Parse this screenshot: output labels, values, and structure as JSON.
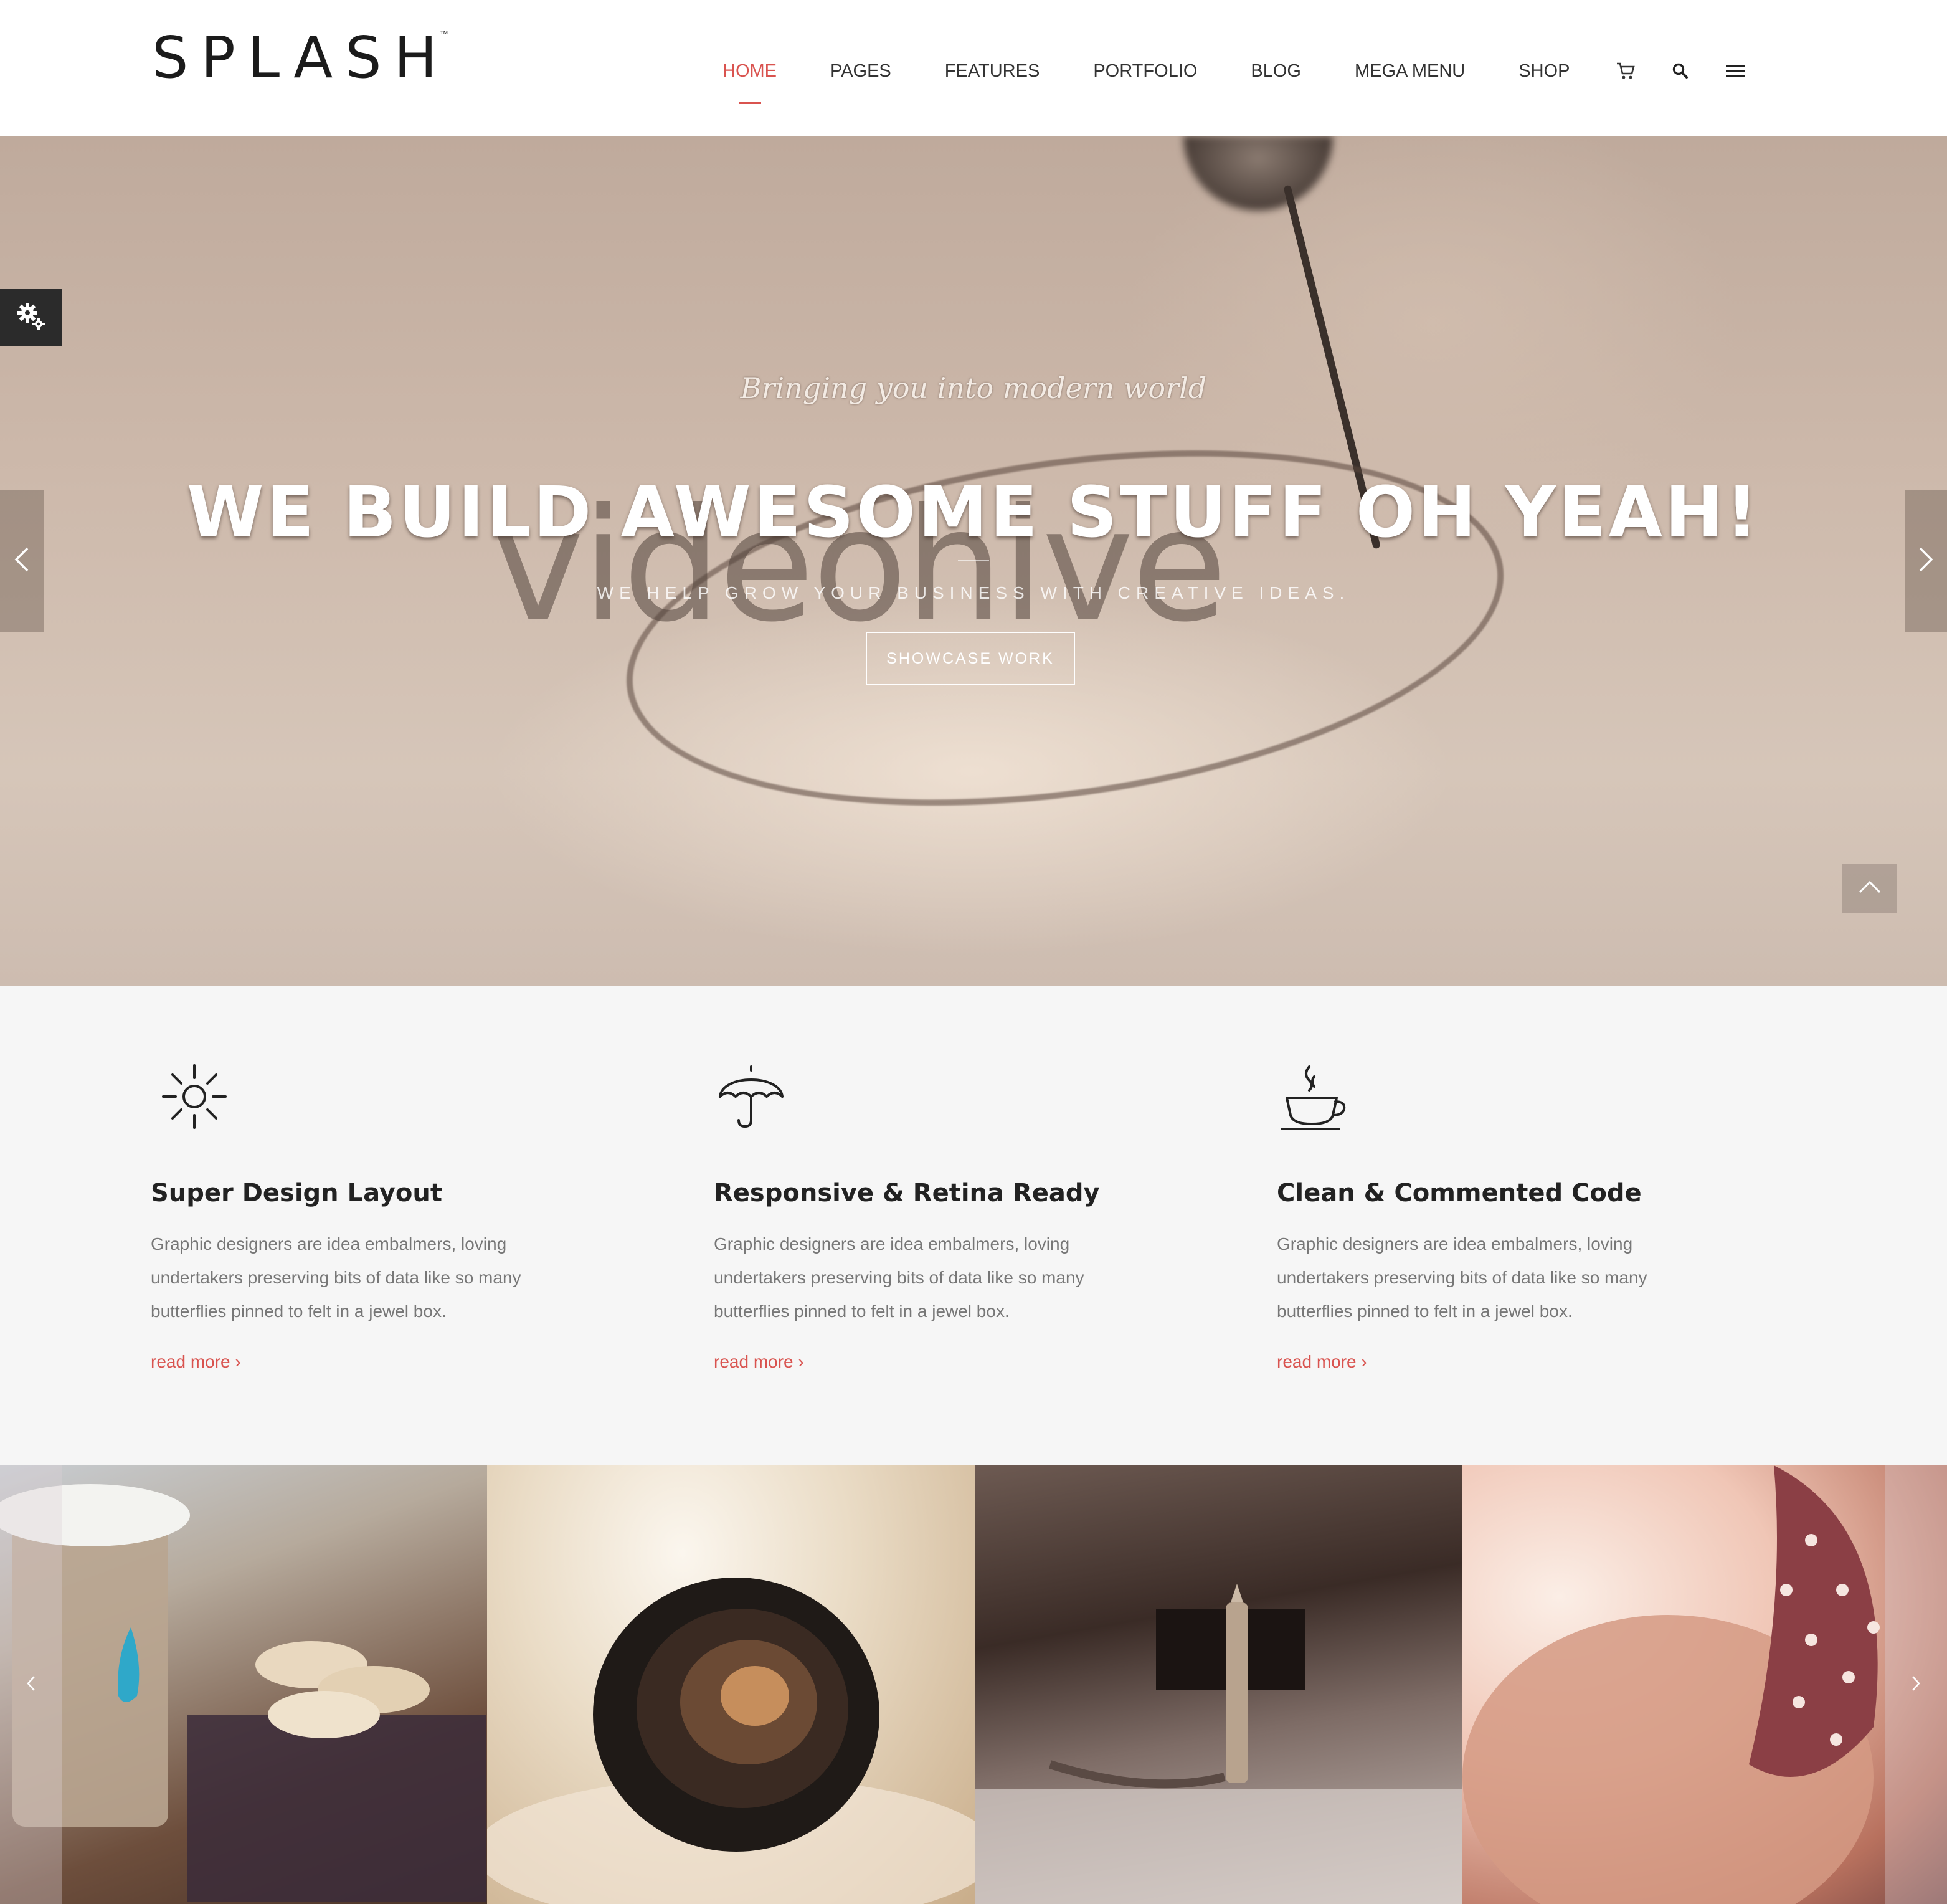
{
  "brand": {
    "logo_text": "SPLASH",
    "logo_tm": "™"
  },
  "nav": {
    "items": [
      {
        "label": "HOME",
        "active": true
      },
      {
        "label": "PAGES",
        "active": false
      },
      {
        "label": "FEATURES",
        "active": false
      },
      {
        "label": "PORTFOLIO",
        "active": false
      },
      {
        "label": "BLOG",
        "active": false
      },
      {
        "label": "MEGA MENU",
        "active": false
      },
      {
        "label": "SHOP",
        "active": false
      }
    ],
    "icons": [
      "cart-icon",
      "search-icon",
      "menu-icon"
    ]
  },
  "hero": {
    "tagline": "Bringing you into modern world",
    "title": "WE BUILD AWESOME STUFF OH YEAH!",
    "subtitle": "WE HELP GROW YOUR BUSINESS WITH CREATIVE IDEAS.",
    "cta_label": "SHOWCASE WORK",
    "watermark": "videohive"
  },
  "features": [
    {
      "icon": "sun-icon",
      "title": "Super Design Layout",
      "text": "Graphic designers are idea embalmers, loving undertakers preserving bits of data like so many butterflies pinned to felt in a jewel box.",
      "link": "read more ›"
    },
    {
      "icon": "umbrella-icon",
      "title": "Responsive & Retina Ready",
      "text": "Graphic designers are idea embalmers, loving undertakers preserving bits of data like so many butterflies pinned to felt in a jewel box.",
      "link": "read more ›"
    },
    {
      "icon": "coffee-cup-icon",
      "title": "Clean & Commented Code",
      "text": "Graphic designers are idea embalmers, loving undertakers preserving bits of data like so many butterflies pinned to felt in a jewel box.",
      "link": "read more ›"
    }
  ],
  "colors": {
    "accent": "#d9534f",
    "heading": "#222222",
    "body_text": "#777777",
    "background": "#f6f6f6"
  }
}
